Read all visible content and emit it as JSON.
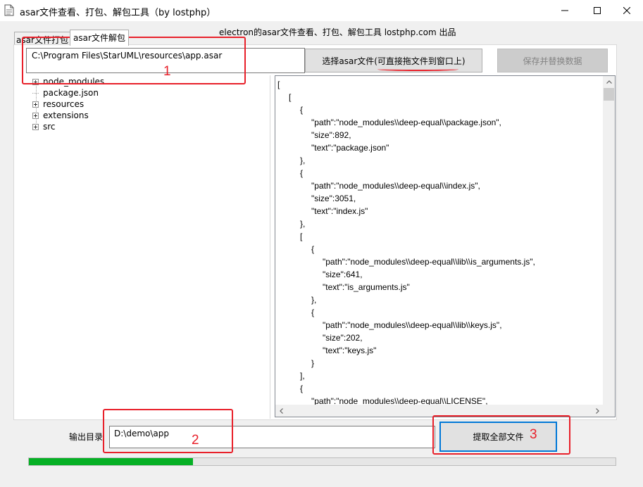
{
  "window": {
    "title": "asar文件查看、打包、解包工具（by lostphp）",
    "subtitle": "electron的asar文件查看、打包、解包工具 lostphp.com 出品"
  },
  "tabs": [
    {
      "label": "asar文件打包",
      "active": false
    },
    {
      "label": "asar文件解包",
      "active": true
    }
  ],
  "unpack": {
    "asar_path": "C:\\Program Files\\StarUML\\resources\\app.asar",
    "select_button": "选择asar文件(可直接拖文件到窗口上)",
    "save_button": "保存并替换数据",
    "tree": [
      "node_modules",
      "package.json",
      "resources",
      "extensions",
      "src"
    ],
    "json_lines": [
      "[",
      "  [",
      "    {",
      "      \"path\":\"node_modules\\\\deep-equal\\\\package.json\",",
      "      \"size\":892,",
      "      \"text\":\"package.json\"",
      "    },",
      "    {",
      "      \"path\":\"node_modules\\\\deep-equal\\\\index.js\",",
      "      \"size\":3051,",
      "      \"text\":\"index.js\"",
      "    },",
      "    [",
      "      {",
      "        \"path\":\"node_modules\\\\deep-equal\\\\lib\\\\is_arguments.js\",",
      "        \"size\":641,",
      "        \"text\":\"is_arguments.js\"",
      "      },",
      "      {",
      "        \"path\":\"node_modules\\\\deep-equal\\\\lib\\\\keys.js\",",
      "        \"size\":202,",
      "        \"text\":\"keys.js\"",
      "      }",
      "    ],",
      "    {",
      "      \"path\":\"node_modules\\\\deep-equal\\\\LICENSE\","
    ],
    "output_label": "输出目录",
    "output_dir": "D:\\demo\\app",
    "extract_button": "提取全部文件",
    "progress": 0.28
  },
  "annotations": {
    "color": "#e8202a",
    "labels": [
      "1",
      "2",
      "3"
    ]
  },
  "colors": {
    "progress_fill": "#06b025",
    "focus_border": "#0078d7"
  },
  "icons": {
    "app": "document-icon",
    "minimize": "minimize-icon",
    "maximize": "maximize-icon",
    "close": "close-icon"
  }
}
